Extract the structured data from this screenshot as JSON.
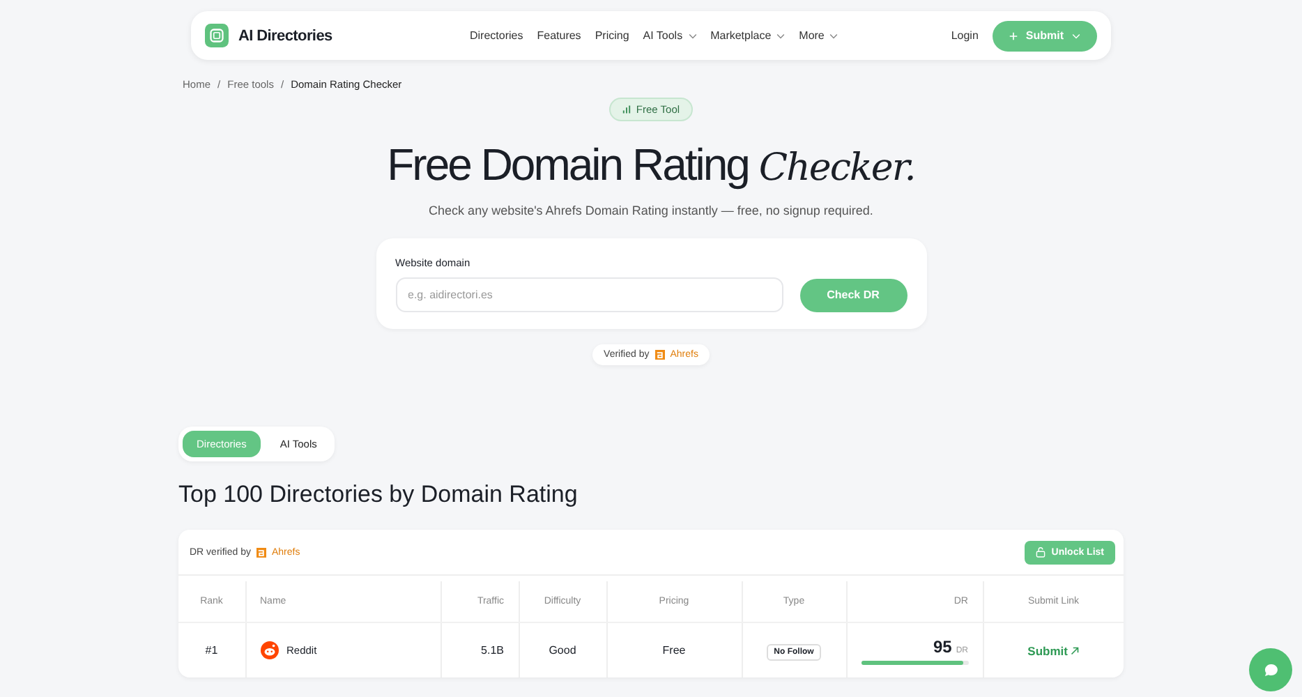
{
  "nav": {
    "brand": "AI Directories",
    "links": [
      {
        "label": "Directories",
        "dropdown": false
      },
      {
        "label": "Features",
        "dropdown": false
      },
      {
        "label": "Pricing",
        "dropdown": false
      },
      {
        "label": "AI Tools",
        "dropdown": true
      },
      {
        "label": "Marketplace",
        "dropdown": true
      },
      {
        "label": "More",
        "dropdown": true
      }
    ],
    "login": "Login",
    "submit": "Submit"
  },
  "breadcrumb_separator": "/",
  "breadcrumb": [
    {
      "label": "Home",
      "current": false
    },
    {
      "label": "Free tools",
      "current": false
    },
    {
      "label": "Domain Rating Checker",
      "current": true
    }
  ],
  "badge": "Free Tool",
  "title": {
    "main": "Free Domain Rating",
    "accent": "Checker."
  },
  "subtitle": "Check any website's Ahrefs Domain Rating instantly — free, no signup required.",
  "form": {
    "label": "Website domain",
    "placeholder": "e.g. aidirectori.es",
    "button": "Check DR"
  },
  "verified": {
    "text": "Verified by",
    "brand": "Ahrefs"
  },
  "tabs": [
    {
      "label": "Directories",
      "selected": true
    },
    {
      "label": "AI Tools",
      "selected": false
    }
  ],
  "heading": "Top 100 Directories by Domain Rating",
  "table": {
    "verified_text": "DR verified by",
    "verified_brand": "Ahrefs",
    "unlock": "Unlock List",
    "columns": [
      "Rank",
      "Name",
      "Traffic",
      "Difficulty",
      "Pricing",
      "Type",
      "DR",
      "Submit Link"
    ],
    "rows": [
      {
        "rank": "#1",
        "name": "Reddit",
        "traffic": "5.1B",
        "difficulty": "Good",
        "pricing": "Free",
        "type": "No Follow",
        "dr": "95",
        "dr_unit": "DR",
        "level": 0.95,
        "submit": "Submit"
      }
    ]
  }
}
